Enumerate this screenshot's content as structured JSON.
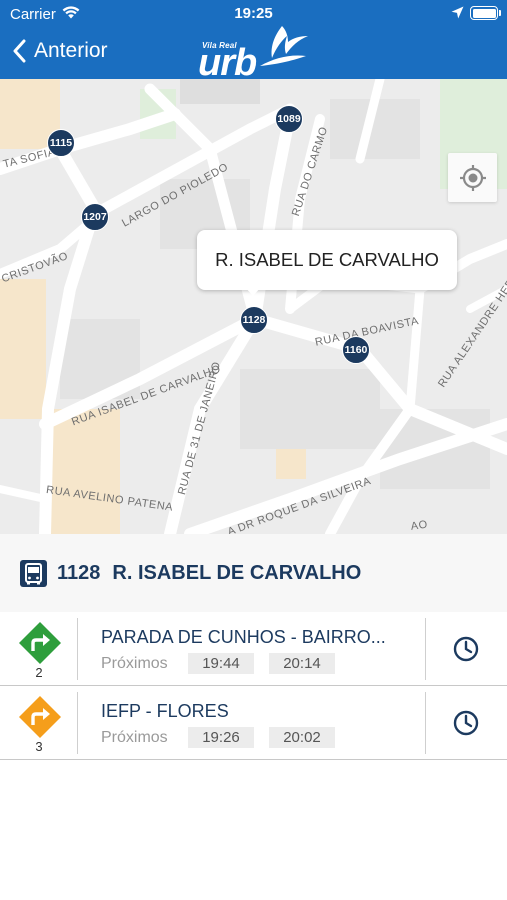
{
  "status_bar": {
    "carrier": "Carrier",
    "time": "19:25"
  },
  "header": {
    "back_label": "Anterior",
    "logo_small": "Vila Real",
    "logo_big": "urb"
  },
  "map": {
    "streets": {
      "sofia": "TA SOFIA",
      "pioledo": "LARGO DO PIOLEDO",
      "carmo": "RUA DO CARMO",
      "cristovao": "CRISTOVÃO",
      "boavista": "RUA DA BOAVISTA",
      "alexandre": "RUA ALEXANDRE HER",
      "isabel": "RUA ISABEL DE CARVALHO",
      "janeiro": "RUA DE 31 DE JANEIRO",
      "avelino": "RUA AVELINO PATENA",
      "roque": "A DR ROQUE DA SILVEIRA",
      "edge": "AO"
    },
    "markers": [
      "1115",
      "1089",
      "1207",
      "1128",
      "1160"
    ],
    "callout": "R. ISABEL DE CARVALHO"
  },
  "stop": {
    "code": "1128",
    "name": "R. ISABEL DE CARVALHO"
  },
  "routes": [
    {
      "line": "2",
      "color": "#2e9e3c",
      "destination": "PARADA DE CUNHOS - BAIRRO...",
      "next_label": "Próximos",
      "times": [
        "19:44",
        "20:14"
      ]
    },
    {
      "line": "3",
      "color": "#f59e1b",
      "destination": "IEFP - FLORES",
      "next_label": "Próximos",
      "times": [
        "19:26",
        "20:02"
      ]
    }
  ],
  "colors": {
    "header": "#1a6ec0",
    "marker": "#1c3a5f",
    "text_primary": "#1c3a5f"
  },
  "icons": {
    "back": "chevron-left-icon",
    "locate": "crosshair-icon",
    "bus": "bus-icon",
    "clock": "clock-icon",
    "route_badge": "turn-right-diamond-icon"
  }
}
